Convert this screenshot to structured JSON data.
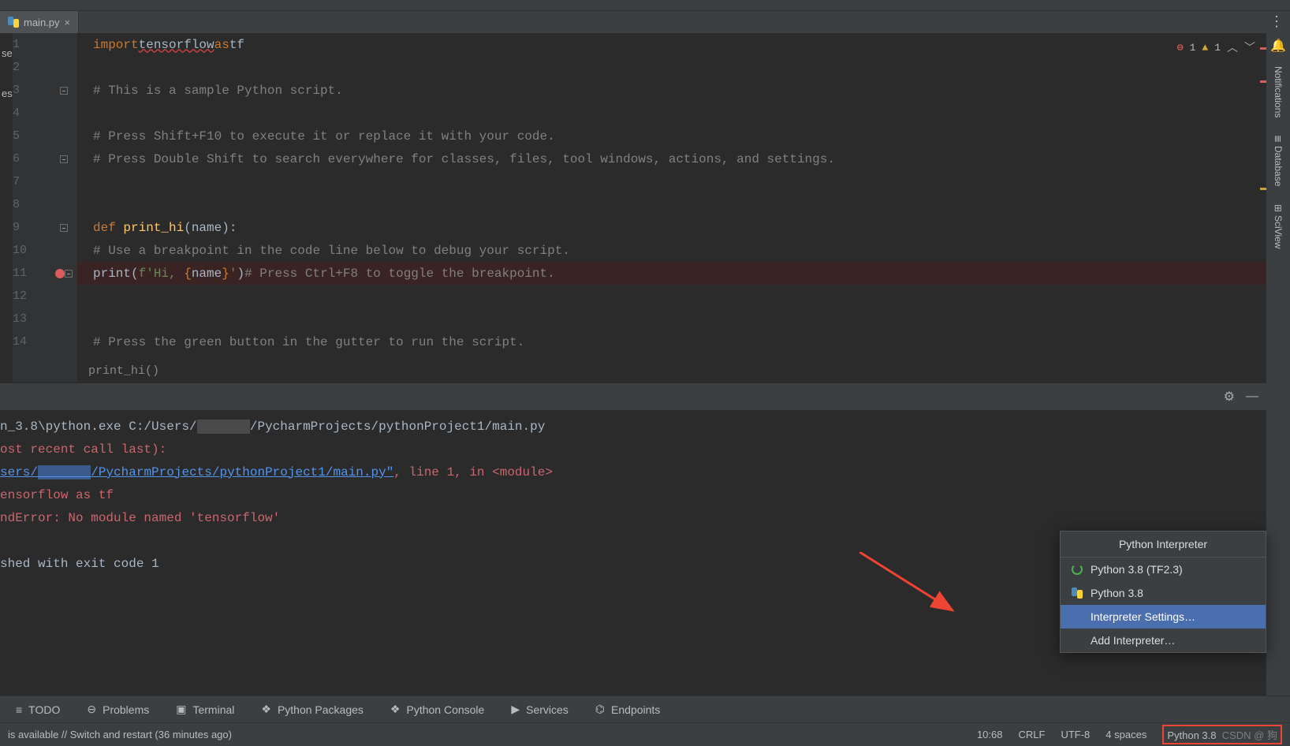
{
  "tab": {
    "filename": "main.py"
  },
  "left_stubs": [
    "ser",
    "es"
  ],
  "right_tools": {
    "notify": "Notifications",
    "db": "Database",
    "sci": "SciView"
  },
  "inspections": {
    "errors": 1,
    "warnings": 1
  },
  "lines": [
    {
      "n": 1,
      "html": "<span class='kw'>import</span> <span class='id err'>tensorflow</span> <span class='kw'>as</span> <span class='id'>tf</span>"
    },
    {
      "n": 2,
      "html": ""
    },
    {
      "n": 3,
      "fold": true,
      "html": "<span class='cmnt'># This is a sample Python script.</span>"
    },
    {
      "n": 4,
      "html": ""
    },
    {
      "n": 5,
      "html": "<span class='cmnt'># Press Shift+F10 to execute it or replace it with your code.</span>"
    },
    {
      "n": 6,
      "fold": true,
      "html": "<span class='cmnt'># Press Double Shift to search everywhere for classes, files, tool windows, actions, and settings.</span>"
    },
    {
      "n": 7,
      "html": ""
    },
    {
      "n": 8,
      "html": ""
    },
    {
      "n": 9,
      "fold": true,
      "html": "<span class='kw'>def </span><span class='fn'>print_hi</span><span class='id'>(name):</span>"
    },
    {
      "n": 10,
      "html": "    <span class='cmnt'># Use a breakpoint in the code line below to debug your script.</span>"
    },
    {
      "n": 11,
      "bp": true,
      "fold": true,
      "html": "    <span class='id'>print(</span><span class='str'>f'Hi, </span><span class='kw'>{</span><span class='id'>name</span><span class='kw'>}</span><span class='str'>'</span><span class='id'>)</span>  <span class='cmnt'># Press Ctrl+F8 to toggle the breakpoint.</span>"
    },
    {
      "n": 12,
      "html": ""
    },
    {
      "n": 13,
      "html": ""
    },
    {
      "n": 14,
      "html": "<span class='cmnt'># Press the green button in the gutter to run the script.</span>"
    }
  ],
  "breadcrumb": "print_hi()",
  "run": {
    "r1": "n_3.8\\python.exe C:/Users/",
    "r1b": "/PycharmProjects/pythonProject1/main.py",
    "r2": "ost recent call last):",
    "r3a": "sers/",
    "r3b": "/PycharmProjects/pythonProject1/main.py\"",
    "r3c": ", line 1, in <module>",
    "r4": "ensorflow as tf",
    "r5": "ndError: No module named 'tensorflow'",
    "r6": "",
    "r7": "shed with exit code 1"
  },
  "popup": {
    "title": "Python Interpreter",
    "item1": "Python 3.8 (TF2.3)",
    "item2": "Python 3.8",
    "item3": "Interpreter Settings…",
    "item4": "Add Interpreter…"
  },
  "toolbar": {
    "todo": "TODO",
    "problems": "Problems",
    "terminal": "Terminal",
    "pkgs": "Python Packages",
    "console": "Python Console",
    "services": "Services",
    "endpoints": "Endpoints"
  },
  "status": {
    "msg": "is available // Switch and restart (36 minutes ago)",
    "pos": "10:68",
    "sep": "CRLF",
    "enc": "UTF-8",
    "indent": "4 spaces",
    "py": "Python 3.8",
    "water": "CSDN @ 狗"
  }
}
